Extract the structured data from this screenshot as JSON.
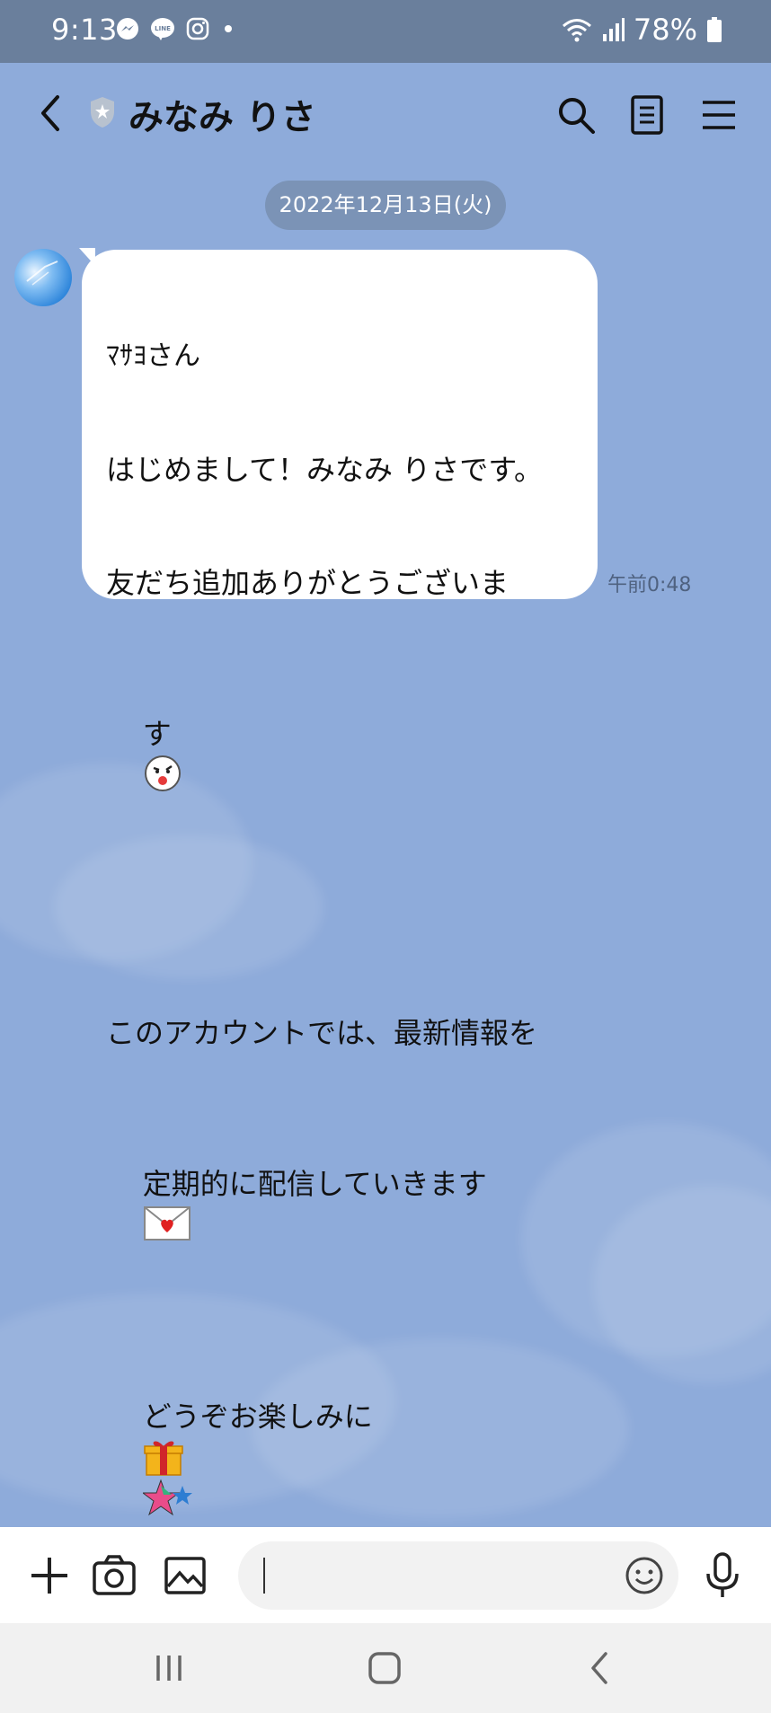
{
  "status_bar": {
    "time": "9:13",
    "notification_icons": [
      "messenger-icon",
      "line-icon",
      "instagram-icon",
      "dot-icon"
    ],
    "battery_percent": "78%",
    "right_icons": [
      "wifi-icon",
      "signal-icon",
      "battery-icon"
    ]
  },
  "header": {
    "title": "みなみ りさ",
    "icons": [
      "back-icon",
      "shield-star-icon",
      "search-icon",
      "notes-icon",
      "menu-icon"
    ]
  },
  "chat": {
    "date_label": "2022年12月13日(火)",
    "messages": [
      {
        "sender_name": "ﾏｻﾖさん",
        "lines": [
          "はじめまして！みなみ りさです。",
          "友だち追加ありがとうございま",
          "す",
          "",
          "このアカウントでは、最新情報を",
          "定期的に配信していきます",
          "どうぞお楽しみに"
        ],
        "emojis": [
          "wink-face-emoji",
          "love-letter-emoji",
          "gift-emoji",
          "stars-emoji"
        ],
        "time": "午前0:48"
      }
    ]
  },
  "input_bar": {
    "icons": [
      "plus-icon",
      "camera-icon",
      "image-icon",
      "emoji-icon",
      "microphone-icon"
    ],
    "message_value": ""
  },
  "nav_bar": {
    "icons": [
      "recents-icon",
      "home-icon",
      "back-nav-icon"
    ]
  },
  "colors": {
    "chat_background": "#8eabda",
    "status_bar": "#6a7f9c",
    "date_pill": "#7b93b6",
    "bubble": "#ffffff"
  }
}
